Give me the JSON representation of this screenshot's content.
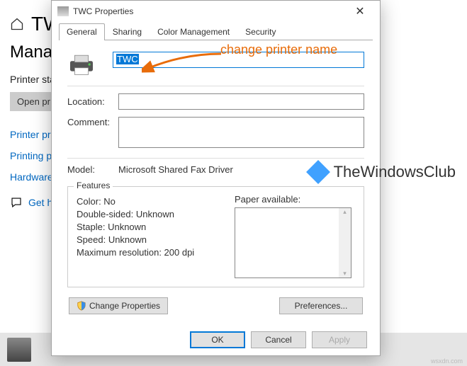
{
  "background": {
    "breadcrumb_prefix": "TW",
    "heading": "Manage",
    "status_label": "Printer sta",
    "open_button": "Open pr",
    "links": {
      "printer_properties": "Printer pro",
      "printing_preferences": "Printing pr",
      "hardware": "Hardware"
    },
    "feedback": "Get h"
  },
  "dialog": {
    "title": "TWC Properties",
    "tabs": [
      "General",
      "Sharing",
      "Color Management",
      "Security"
    ],
    "active_tab": "General",
    "name_value": "TWC",
    "location_label": "Location:",
    "location_value": "",
    "comment_label": "Comment:",
    "comment_value": "",
    "model_label": "Model:",
    "model_value": "Microsoft Shared Fax Driver",
    "features": {
      "legend": "Features",
      "color": "Color: No",
      "double_sided": "Double-sided: Unknown",
      "staple": "Staple: Unknown",
      "speed": "Speed: Unknown",
      "max_resolution": "Maximum resolution: 200 dpi",
      "paper_header": "Paper available:"
    },
    "buttons": {
      "change_properties": "Change Properties",
      "preferences": "Preferences...",
      "ok": "OK",
      "cancel": "Cancel",
      "apply": "Apply"
    }
  },
  "annotation": "change printer name",
  "watermark": "TheWindowsClub",
  "source": "wsxdn.com"
}
